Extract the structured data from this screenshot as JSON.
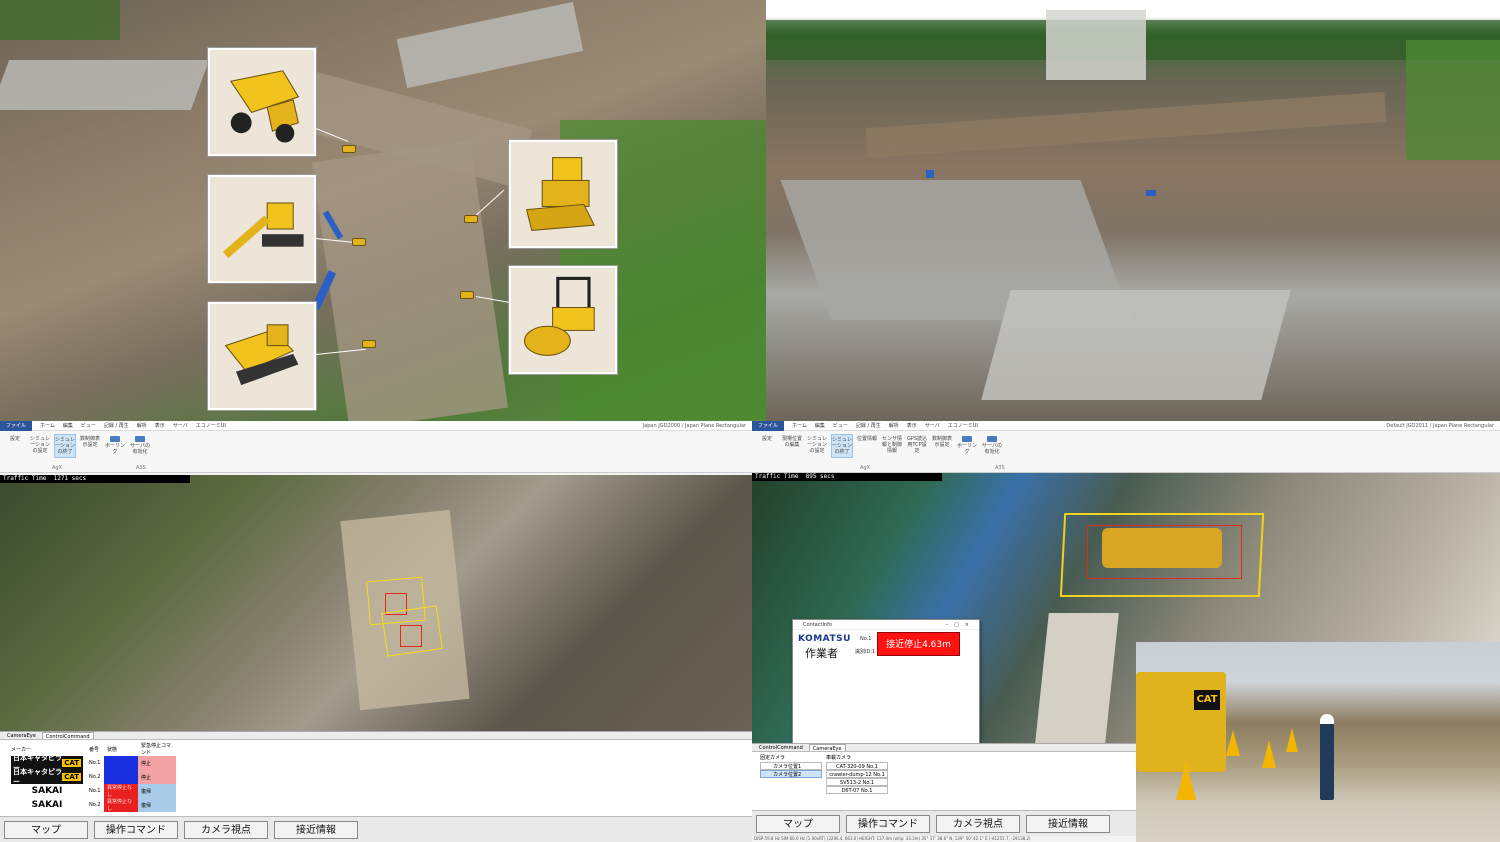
{
  "q1": {
    "insets": [
      {
        "name": "dump-truck"
      },
      {
        "name": "excavator"
      },
      {
        "name": "crawler-dumper"
      },
      {
        "name": "bulldozer"
      },
      {
        "name": "road-roller"
      }
    ]
  },
  "q3": {
    "ribbon_tabs": [
      "ファイル",
      "ホーム",
      "編集",
      "ビュー",
      "記録 / 再生",
      "解析",
      "表示",
      "サーバ",
      "エコノーミUI"
    ],
    "ribbon_right": "Japan   JGD2000 / Japan Plane Rectangular",
    "buttons": [
      {
        "label": "設定"
      },
      {
        "label": "シミュレーションの設定"
      },
      {
        "label": "シミュレーションの終了"
      },
      {
        "label": "数制御表示設定"
      },
      {
        "label": "ボーリング"
      },
      {
        "label": "サーバの有効化"
      }
    ],
    "group_agx": "AgX",
    "group_a3s": "A3S",
    "traffic_label": "Traffic Time",
    "traffic_value": "1271 secs",
    "panel_tabs": [
      "CameraEye",
      "ControlCommand"
    ],
    "table_headers": [
      "メーカー",
      "番号",
      "状態",
      "緊急停止コマンド"
    ],
    "vehicles": [
      {
        "maker": "日本キャタピラー",
        "brand": "CAT",
        "no": "No.1",
        "state": "",
        "emergency": "停止"
      },
      {
        "maker": "日本キャタピラー",
        "brand": "CAT",
        "no": "No.2",
        "state": "",
        "emergency": "停止"
      },
      {
        "maker": "SAKAI",
        "brand": "",
        "no": "No.1",
        "state": "異常停止なし",
        "emergency": "復帰"
      },
      {
        "maker": "SAKAI",
        "brand": "",
        "no": "No.2",
        "state": "異常停止なし",
        "emergency": "復帰"
      }
    ],
    "bottom_buttons": [
      "マップ",
      "操作コマンド",
      "カメラ視点",
      "接近情報"
    ]
  },
  "q4": {
    "ribbon_tabs": [
      "ファイル",
      "ホーム",
      "編集",
      "ビュー",
      "記録 / 再生",
      "解析",
      "表示",
      "サーバ",
      "エコノーミUI"
    ],
    "ribbon_right": "Default   JGD2011 / Japan Plane Rectangular",
    "buttons": [
      {
        "label": "設定"
      },
      {
        "label": "現場位置の編集"
      },
      {
        "label": "シミュレーションの設定"
      },
      {
        "label": "シミュレーションの終了"
      },
      {
        "label": "位置情報"
      },
      {
        "label": "センサ情報と制御情報"
      },
      {
        "label": "GPS読込用TCP設定"
      },
      {
        "label": "数制御表示設定"
      },
      {
        "label": "ボーリング"
      },
      {
        "label": "サーバの有効化"
      }
    ],
    "group_agx": "AgX",
    "group_a3s": "A3S",
    "traffic_label": "Traffic Time",
    "traffic_value": "895 secs",
    "dialog": {
      "title": "ContactInfo",
      "brand": "KOMATSU",
      "worker": "作業者",
      "no": "No.1",
      "id_label": "識別ID:1",
      "alert": "接近停止4.63m"
    },
    "panel_tabs": [
      "ControlCommand",
      "CameraEye"
    ],
    "camera_headers": [
      "固定カメラ",
      "車載カメラ"
    ],
    "fixed_cameras": [
      "カメラ位置1",
      "カメラ位置2"
    ],
    "onboard_cameras": [
      "CAT-320-09 No.1",
      "crawler-dump-12 No.1",
      "SV513-2 No.1",
      "D6T-07 No.1"
    ],
    "bottom_buttons": [
      "マップ",
      "操作コマンド",
      "カメラ視点",
      "接近情報"
    ],
    "status_line": "DISP:59.8 Hz  SIM:60.0 Hz (1.00xRT)        (2296.4, 663.0)  HEIGHT: 137.4m (ellip: 33.3m)        35° 37' 38.6\" N, 139° 50' 42.1\" E   (-41251.7, -29138.2)"
  },
  "colors": {
    "cat_yellow": "#f7c300",
    "alert_red": "#ff1212",
    "state_blue": "#1a2fe0",
    "state_red": "#e82020"
  }
}
